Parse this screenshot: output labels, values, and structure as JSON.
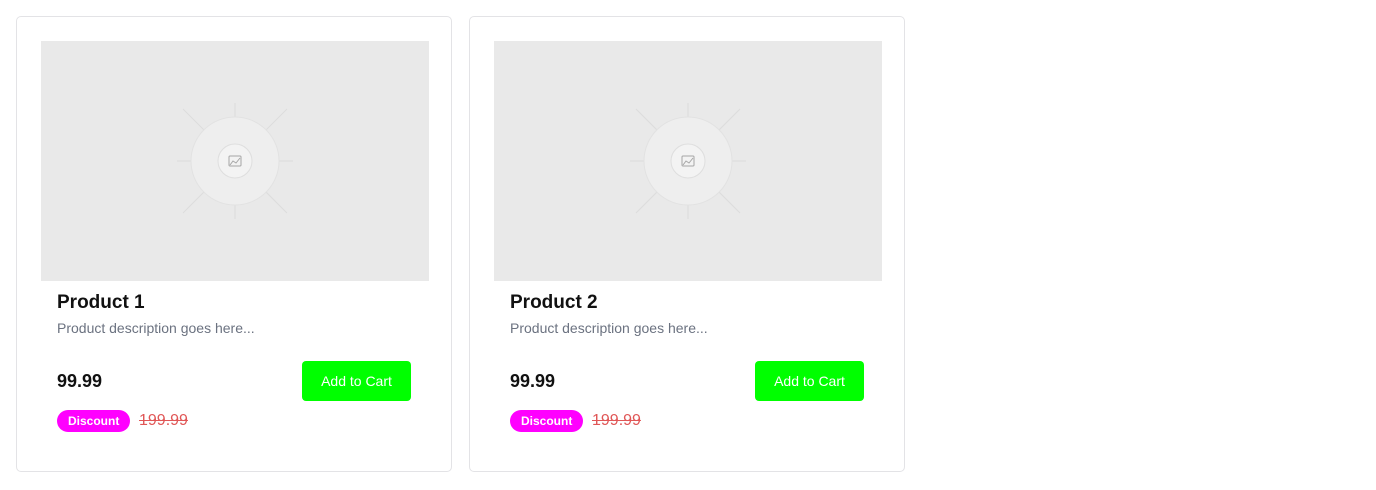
{
  "products": [
    {
      "title": "Product 1",
      "description": "Product description goes here...",
      "price": "99.99",
      "add_to_cart_label": "Add to Cart",
      "discount_label": "Discount",
      "original_price": "199.99",
      "image_icon": "image-placeholder-icon"
    },
    {
      "title": "Product 2",
      "description": "Product description goes here...",
      "price": "99.99",
      "add_to_cart_label": "Add to Cart",
      "discount_label": "Discount",
      "original_price": "199.99",
      "image_icon": "image-placeholder-icon"
    }
  ],
  "colors": {
    "button": "#00ff00",
    "badge": "#ff00ff",
    "original_price": "#e05656",
    "image_bg": "#e9e9e9"
  }
}
